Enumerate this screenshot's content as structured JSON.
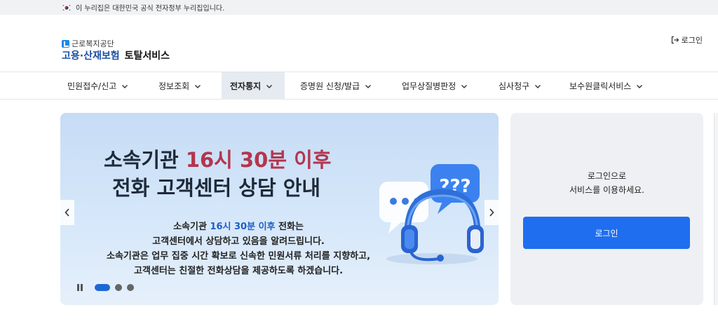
{
  "gov_banner": {
    "text": "이 누리집은 대한민국 공식 전자정부 누리집입니다."
  },
  "header": {
    "org_name": "근로복지공단",
    "service_title_part1": "고용·산재보험",
    "service_title_part2": "토탈서비스",
    "login_link": "로그인"
  },
  "nav": {
    "items": [
      {
        "label": "민원접수/신고"
      },
      {
        "label": "정보조회"
      },
      {
        "label": "전자통지",
        "active": true
      },
      {
        "label": "증명원 신청/발급"
      },
      {
        "label": "업무상질병판정"
      },
      {
        "label": "심사청구"
      },
      {
        "label": "보수원클릭서비스"
      }
    ]
  },
  "banner": {
    "title1_prefix": "소속기관 ",
    "title1_highlight": "16시 30분 이후",
    "title2": "전화 고객센터 상담 안내",
    "line1_prefix": "소속기관 ",
    "line1_highlight": "16시 30분 이후",
    "line1_suffix": " 전화는",
    "line2": "고객센터에서 상담하고 있음을 알려드립니다.",
    "line3": "소속기관은 업무 집중 시간 확보로 신속한 민원서류 처리를 지향하고,",
    "line4": "고객센터는 친절한 전화상담을 제공하도록 하겠습니다.",
    "bubble_text": "???"
  },
  "side": {
    "message_line1": "로그인으로",
    "message_line2": "서비스를 이용하세요.",
    "login_button": "로그인"
  },
  "colors": {
    "primary_blue": "#1f6ef0",
    "highlight_red": "#b3364d",
    "highlight_blue": "#1e5fc7",
    "nav_active_bg": "#e6ebf1"
  }
}
